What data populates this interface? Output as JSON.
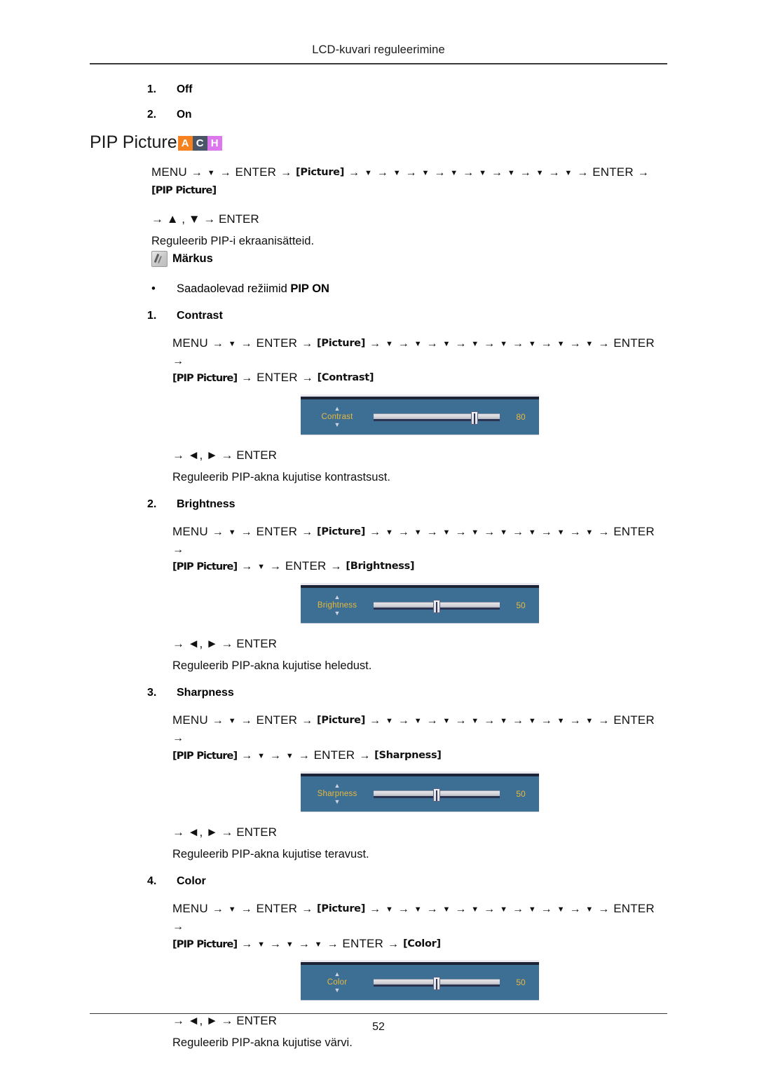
{
  "header": {
    "title": "LCD-kuvari reguleerimine"
  },
  "top_list": [
    {
      "num": "1.",
      "label": "Off"
    },
    {
      "num": "2.",
      "label": "On"
    }
  ],
  "section": {
    "title": "PIP Picture",
    "badges": [
      {
        "letter": "A",
        "color": "#F5821F"
      },
      {
        "letter": "C",
        "color": "#4A5568"
      },
      {
        "letter": "H",
        "color": "#DD77EE"
      }
    ],
    "path": {
      "menu": "MENU",
      "enter": "ENTER",
      "picture_token": "[Picture]",
      "pip_token": "[PIP Picture]",
      "down_count": 8
    },
    "keyline": "→ ▲ , ▼ → ENTER",
    "description": "Reguleerib PIP-i ekraanisätteid.",
    "note_label": "Märkus",
    "bullet": {
      "dot": "•",
      "text": "Saadaolevad režiimid ",
      "strong": "PIP ON"
    }
  },
  "items": [
    {
      "num": "1.",
      "title": "Contrast",
      "path_tail_downs": 0,
      "path_end_token": "[Contrast]",
      "keyline": "→ ◄, ► → ENTER",
      "description": "Reguleerib PIP-akna kujutise kontrastsust.",
      "osd": {
        "label": "Contrast",
        "value": "80",
        "percent": 80,
        "up_caret": "▲",
        "down_caret": "▼"
      }
    },
    {
      "num": "2.",
      "title": "Brightness",
      "path_tail_downs": 1,
      "path_end_token": "[Brightness]",
      "keyline": "→ ◄, ► → ENTER",
      "description": "Reguleerib PIP-akna kujutise heledust.",
      "osd": {
        "label": "Brightness",
        "value": "50",
        "percent": 50,
        "up_caret": "▲",
        "down_caret": "▼"
      }
    },
    {
      "num": "3.",
      "title": "Sharpness",
      "path_tail_downs": 2,
      "path_end_token": "[Sharpness]",
      "keyline": "→ ◄, ► → ENTER",
      "description": "Reguleerib PIP-akna kujutise teravust.",
      "osd": {
        "label": "Sharpness",
        "value": "50",
        "percent": 50,
        "up_caret": "▲",
        "down_caret": "▼"
      }
    },
    {
      "num": "4.",
      "title": "Color",
      "path_tail_downs": 3,
      "path_end_token": "[Color]",
      "keyline": "→ ◄, ► → ENTER",
      "description": "Reguleerib PIP-akna kujutise värvi.",
      "osd": {
        "label": "Color",
        "value": "50",
        "percent": 50,
        "up_caret": "▲",
        "down_caret": "▼"
      }
    }
  ],
  "footer": {
    "page_number": "52"
  }
}
